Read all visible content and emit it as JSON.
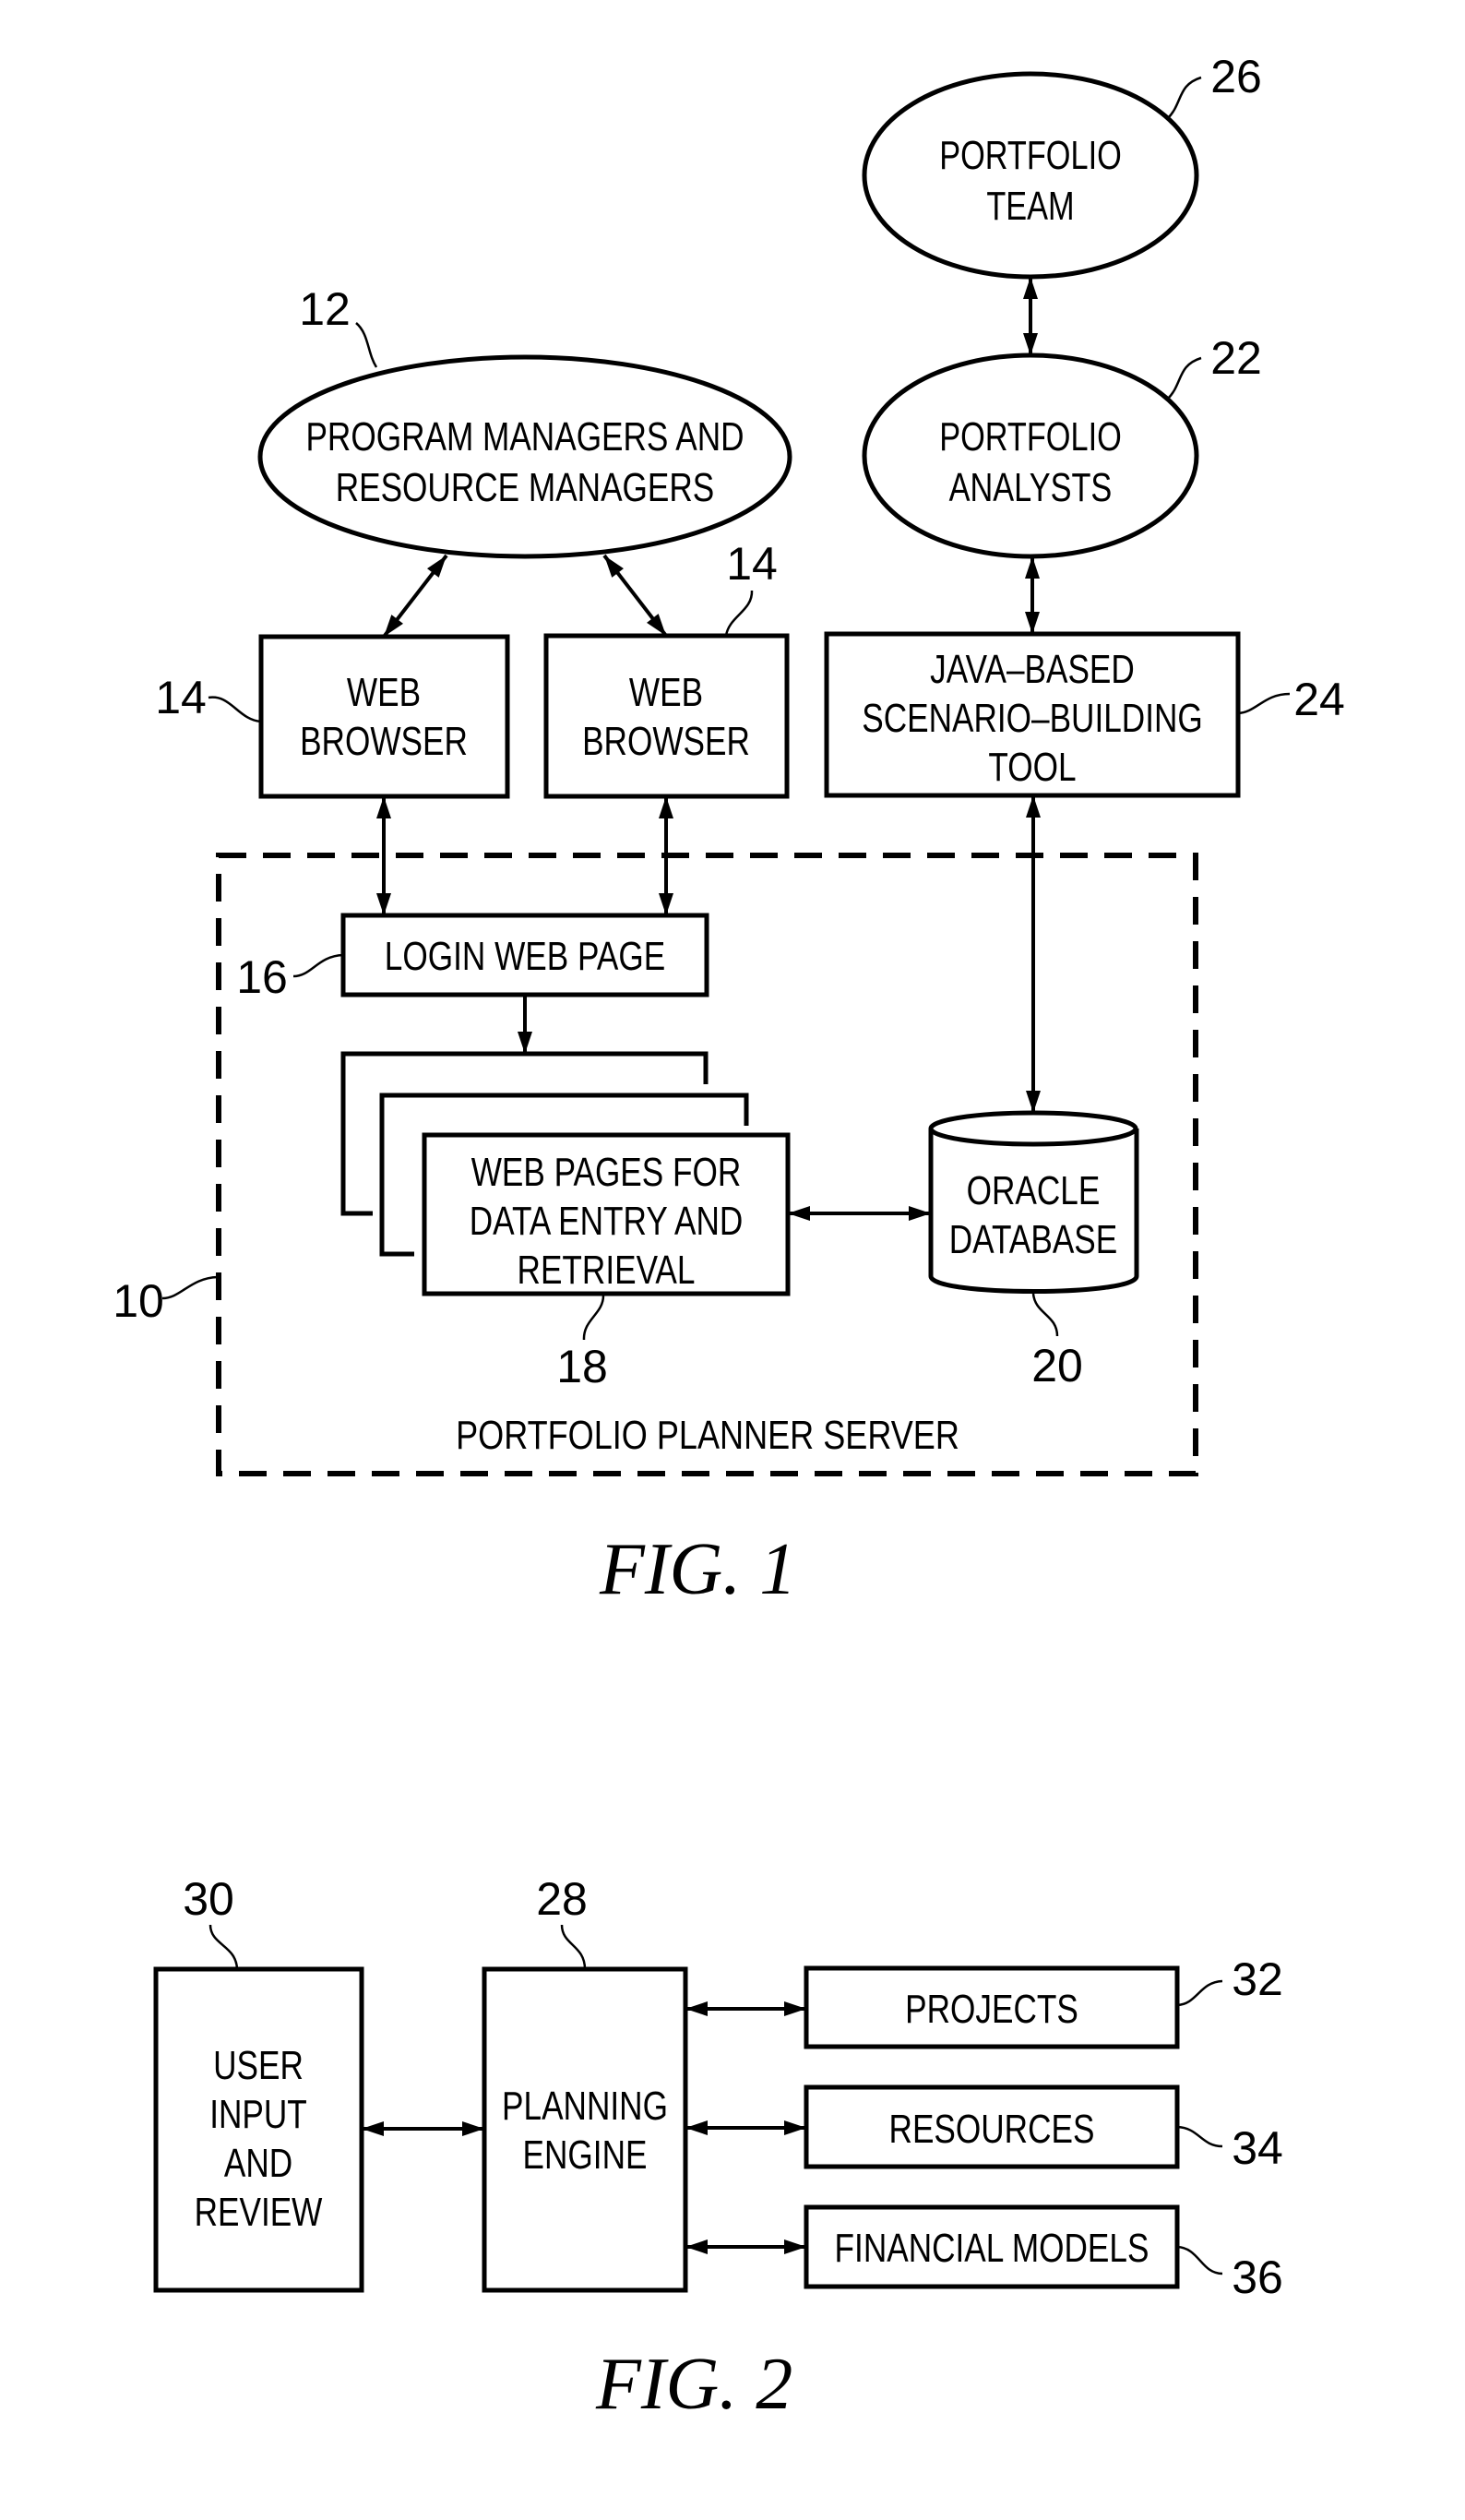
{
  "figure1": {
    "caption": "FIG.  1",
    "nodes": {
      "portfolio_team": {
        "ref": "26",
        "lines": [
          "PORTFOLIO",
          "TEAM"
        ]
      },
      "portfolio_analysts": {
        "ref": "22",
        "lines": [
          "PORTFOLIO",
          "ANALYSTS"
        ]
      },
      "program_managers": {
        "ref": "12",
        "lines": [
          "PROGRAM  MANAGERS  AND",
          "RESOURCE  MANAGERS"
        ]
      },
      "web_browser_1": {
        "ref": "14",
        "lines": [
          "WEB",
          "BROWSER"
        ]
      },
      "web_browser_2": {
        "ref": "14",
        "lines": [
          "WEB",
          "BROWSER"
        ]
      },
      "scenario_tool": {
        "ref": "24",
        "lines": [
          "JAVA–BASED",
          "SCENARIO–BUILDING",
          "TOOL"
        ]
      },
      "login_page": {
        "ref": "16",
        "lines": [
          "LOGIN  WEB  PAGE"
        ]
      },
      "web_pages": {
        "ref": "18",
        "lines": [
          "WEB  PAGES  FOR",
          "DATA  ENTRY  AND",
          "RETRIEVAL"
        ]
      },
      "oracle_db": {
        "ref": "20",
        "lines": [
          "ORACLE",
          "DATABASE"
        ]
      },
      "server": {
        "ref": "10",
        "label": "PORTFOLIO  PLANNER  SERVER"
      }
    }
  },
  "figure2": {
    "caption": "FIG.  2",
    "nodes": {
      "user_input": {
        "ref": "30",
        "lines": [
          "USER",
          "INPUT",
          "AND",
          "REVIEW"
        ]
      },
      "planning_engine": {
        "ref": "28",
        "lines": [
          "PLANNING",
          "ENGINE"
        ]
      },
      "projects": {
        "ref": "32",
        "lines": [
          "PROJECTS"
        ]
      },
      "resources": {
        "ref": "34",
        "lines": [
          "RESOURCES"
        ]
      },
      "financial_models": {
        "ref": "36",
        "lines": [
          "FINANCIAL  MODELS"
        ]
      }
    }
  }
}
